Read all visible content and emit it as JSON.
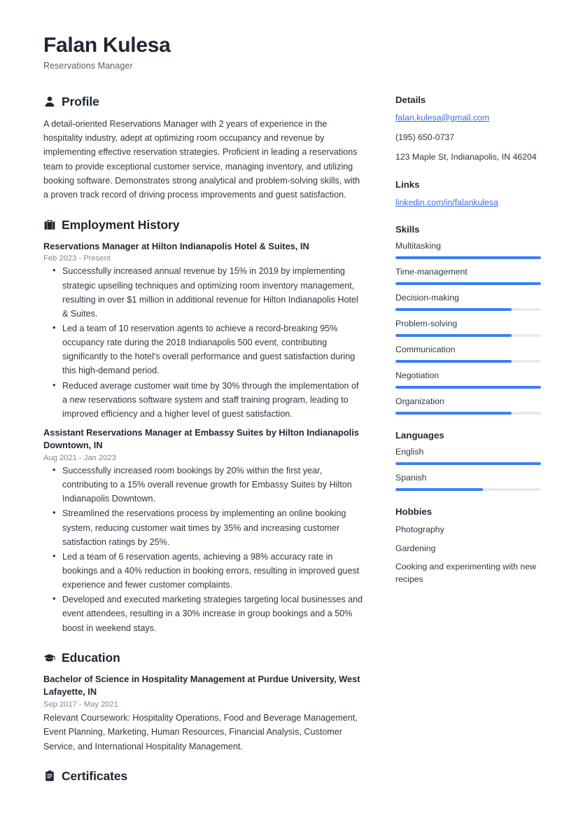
{
  "header": {
    "name": "Falan Kulesa",
    "job_title": "Reservations Manager"
  },
  "accent_color": "#3b7ff5",
  "link_color": "#3b6fd4",
  "text_color": "#2c3744",
  "sections": {
    "profile": {
      "title": "Profile",
      "icon": "person-icon",
      "text": "A detail-oriented Reservations Manager with 2 years of experience in the hospitality industry, adept at optimizing room occupancy and revenue by implementing effective reservation strategies. Proficient in leading a reservations team to provide exceptional customer service, managing inventory, and utilizing booking software. Demonstrates strong analytical and problem-solving skills, with a proven track record of driving process improvements and guest satisfaction."
    },
    "employment": {
      "title": "Employment History",
      "icon": "briefcase-icon",
      "entries": [
        {
          "title": "Reservations Manager at Hilton Indianapolis Hotel & Suites, IN",
          "date": "Feb 2023 - Present",
          "bullets": [
            "Successfully increased annual revenue by 15% in 2019 by implementing strategic upselling techniques and optimizing room inventory management, resulting in over $1 million in additional revenue for Hilton Indianapolis Hotel & Suites.",
            "Led a team of 10 reservation agents to achieve a record-breaking 95% occupancy rate during the 2018 Indianapolis 500 event, contributing significantly to the hotel's overall performance and guest satisfaction during this high-demand period.",
            "Reduced average customer wait time by 30% through the implementation of a new reservations software system and staff training program, leading to improved efficiency and a higher level of guest satisfaction."
          ]
        },
        {
          "title": "Assistant Reservations Manager at Embassy Suites by Hilton Indianapolis Downtown, IN",
          "date": "Aug 2021 - Jan 2023",
          "bullets": [
            "Successfully increased room bookings by 20% within the first year, contributing to a 15% overall revenue growth for Embassy Suites by Hilton Indianapolis Downtown.",
            "Streamlined the reservations process by implementing an online booking system, reducing customer wait times by 35% and increasing customer satisfaction ratings by 25%.",
            "Led a team of 6 reservation agents, achieving a 98% accuracy rate in bookings and a 40% reduction in booking errors, resulting in improved guest experience and fewer customer complaints.",
            "Developed and executed marketing strategies targeting local businesses and event attendees, resulting in a 30% increase in group bookings and a 50% boost in weekend stays."
          ]
        }
      ]
    },
    "education": {
      "title": "Education",
      "icon": "graduation-cap-icon",
      "entries": [
        {
          "title": "Bachelor of Science in Hospitality Management at Purdue University, West Lafayette, IN",
          "date": "Sep 2017 - May 2021",
          "description": "Relevant Coursework: Hospitality Operations, Food and Beverage Management, Event Planning, Marketing, Human Resources, Financial Analysis, Customer Service, and International Hospitality Management."
        }
      ]
    },
    "certificates": {
      "title": "Certificates",
      "icon": "clipboard-icon"
    }
  },
  "sidebar": {
    "details": {
      "title": "Details",
      "email": "falan.kulesa@gmail.com",
      "phone": "(195) 650-0737",
      "address": "123 Maple St, Indianapolis, IN 46204"
    },
    "links": {
      "title": "Links",
      "items": [
        {
          "label": "linkedin.com/in/falankulesa"
        }
      ]
    },
    "skills": {
      "title": "Skills",
      "items": [
        {
          "label": "Multitasking",
          "level": 100
        },
        {
          "label": "Time-management",
          "level": 100
        },
        {
          "label": "Decision-making",
          "level": 80
        },
        {
          "label": "Problem-solving",
          "level": 80
        },
        {
          "label": "Communication",
          "level": 80
        },
        {
          "label": "Negotiation",
          "level": 100
        },
        {
          "label": "Organization",
          "level": 80
        }
      ]
    },
    "languages": {
      "title": "Languages",
      "items": [
        {
          "label": "English",
          "level": 100
        },
        {
          "label": "Spanish",
          "level": 60
        }
      ]
    },
    "hobbies": {
      "title": "Hobbies",
      "items": [
        {
          "label": "Photography"
        },
        {
          "label": "Gardening"
        },
        {
          "label": "Cooking and experimenting with new recipes"
        }
      ]
    }
  }
}
